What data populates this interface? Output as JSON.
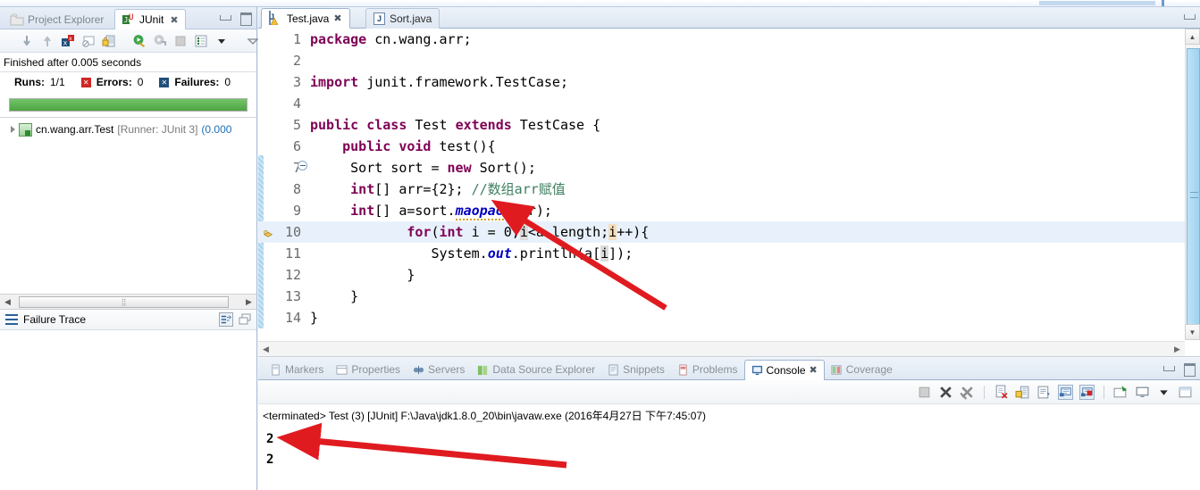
{
  "junit_view": {
    "tabs": [
      {
        "label": "Project Explorer",
        "active": false,
        "icon": "project-explorer-icon"
      },
      {
        "label": "JUnit",
        "active": true,
        "icon": "junit-icon"
      }
    ],
    "close_glyph": "✖",
    "status_text": "Finished after 0.005 seconds",
    "counts": {
      "runs_label": "Runs:",
      "runs_value": "1/1",
      "errors_label": "Errors:",
      "errors_value": "0",
      "failures_label": "Failures:",
      "failures_value": "0"
    },
    "progress": {
      "percent": 100,
      "color": "#4ca544"
    },
    "tree": [
      {
        "name": "cn.wang.arr.Test",
        "runner": "[Runner: JUnit 3]",
        "time": "(0.000"
      }
    ],
    "failure_trace_label": "Failure Trace",
    "toolbar_icons": [
      "next-failure-icon",
      "previous-failure-icon",
      "show-failures-icon",
      "show-disabled-icon",
      "lock-history-icon",
      "rerun-test-icon",
      "rerun-failed-icon",
      "stop-icon",
      "test-history-icon",
      "view-menu-arrow-icon",
      "minimize-arrow-icon"
    ]
  },
  "editor": {
    "tabs": [
      {
        "label": "Test.java",
        "active": true,
        "icon": "java-file-warning-icon"
      },
      {
        "label": "Sort.java",
        "active": false,
        "icon": "java-file-icon"
      }
    ],
    "close_glyph": "✖",
    "lines": [
      {
        "num": "1",
        "text": "package cn.wang.arr;"
      },
      {
        "num": "2",
        "text": ""
      },
      {
        "num": "3",
        "text": "import junit.framework.TestCase;"
      },
      {
        "num": "4",
        "text": ""
      },
      {
        "num": "5",
        "text": "public class Test extends TestCase {"
      },
      {
        "num": "6",
        "text": "    public void test(){"
      },
      {
        "num": "7",
        "text": "     Sort sort = new Sort();"
      },
      {
        "num": "8",
        "text": "     int[] arr={2}; //数组arr赋值"
      },
      {
        "num": "9",
        "text": "     int[] a=sort.maopao(arr);"
      },
      {
        "num": "10",
        "text": "            for(int i = 0;i<a.length;i++){"
      },
      {
        "num": "11",
        "text": "               System.out.println(a[i]);"
      },
      {
        "num": "12",
        "text": "            }"
      },
      {
        "num": "13",
        "text": "     }"
      },
      {
        "num": "14",
        "text": "}"
      }
    ],
    "highlight_line": "10"
  },
  "bottom_panel": {
    "tabs": [
      {
        "label": "Markers",
        "active": false,
        "icon": "markers-icon"
      },
      {
        "label": "Properties",
        "active": false,
        "icon": "properties-icon"
      },
      {
        "label": "Servers",
        "active": false,
        "icon": "servers-icon"
      },
      {
        "label": "Data Source Explorer",
        "active": false,
        "icon": "data-source-icon"
      },
      {
        "label": "Snippets",
        "active": false,
        "icon": "snippets-icon"
      },
      {
        "label": "Problems",
        "active": false,
        "icon": "problems-icon"
      },
      {
        "label": "Console",
        "active": true,
        "icon": "console-icon"
      },
      {
        "label": "Coverage",
        "active": false,
        "icon": "coverage-icon"
      }
    ],
    "close_glyph": "✖",
    "toolbar_icons": [
      "terminate-icon",
      "remove-launch-icon",
      "remove-all-launches-icon",
      "clear-console-icon",
      "scroll-lock-icon",
      "word-wrap-icon",
      "show-console-on-output-icon",
      "show-console-on-error-icon",
      "pin-console-icon",
      "display-selected-console-icon",
      "console-menu-arrow-icon",
      "open-console-icon"
    ],
    "console": {
      "terminated_line": "<terminated> Test (3) [JUnit] F:\\Java\\jdk1.8.0_20\\bin\\javaw.exe (2016年4月27日 下午7:45:07)",
      "output": [
        "2",
        "2"
      ]
    }
  },
  "annotations": {
    "arrow_color": "#e01b20",
    "arrows": [
      {
        "name": "code-arrow",
        "from": [
          743,
          344
        ],
        "to": [
          556,
          228
        ]
      },
      {
        "name": "console-arrow",
        "from": [
          632,
          521
        ],
        "to": [
          318,
          491
        ]
      }
    ]
  },
  "window_buttons": {
    "minimize": "minimize-icon",
    "maximize": "maximize-icon"
  }
}
